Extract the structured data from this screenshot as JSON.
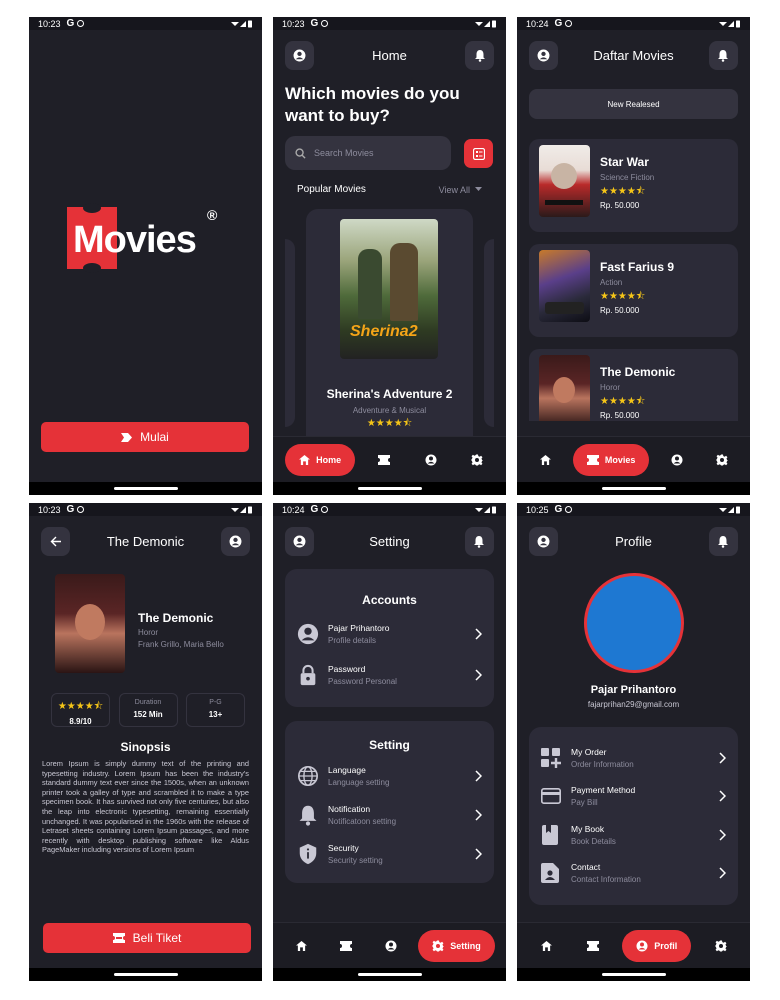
{
  "status": {
    "times": [
      "10:23",
      "10:23",
      "10:24",
      "10:23",
      "10:24",
      "10:25"
    ],
    "g": "G"
  },
  "splash": {
    "logo_text": "Movies",
    "logo_reg": "®",
    "start_label": "Mulai"
  },
  "home": {
    "title": "Home",
    "headline_1": "Which movies do you",
    "headline_2": "want to buy?",
    "search_placeholder": "Search Movies",
    "popular_label": "Popular Movies",
    "view_all": "View All",
    "featured": {
      "poster_text": "Sherina2",
      "title": "Sherina's Adventure 2",
      "genre": "Adventure & Musical",
      "rating_stars": 4.5
    },
    "nav_active_label": "Home"
  },
  "list": {
    "title": "Daftar Movies",
    "tab_label": "New Realesed",
    "movies": [
      {
        "title": "Star War",
        "genre": "Science Fiction",
        "price": "Rp. 50.000",
        "stars": 4.5
      },
      {
        "title": "Fast Farius 9",
        "genre": "Action",
        "price": "Rp. 50.000",
        "stars": 4.5
      },
      {
        "title": "The Demonic",
        "genre": "Horor",
        "price": "Rp. 50.000",
        "stars": 4.5
      }
    ],
    "nav_active_label": "Movies"
  },
  "detail": {
    "title": "The Demonic",
    "movie_title": "The Demonic",
    "genre": "Horor",
    "cast": "Frank Grillo, Maria Bello",
    "rating": "8.9/10",
    "duration_label": "Duration",
    "duration_value": "152 Min",
    "pg_label": "P-G",
    "pg_value": "13+",
    "synopsis_title": "Sinopsis",
    "synopsis": "Lorem Ipsum is simply dummy text of the printing and typesetting industry. Lorem Ipsum has been the industry's standard dummy text ever since the 1500s, when an unknown printer took a galley of type and scrambled it to make a type specimen book. It has survived not only five centuries, but also the leap into electronic typesetting, remaining essentially unchanged. It was popularised in the 1960s with the release of Letraset sheets containing Lorem Ipsum passages, and more recently with desktop publishing software like Aldus PageMaker including versions of Lorem Ipsum",
    "buy_label": "Beli Tiket"
  },
  "setting": {
    "title": "Setting",
    "accounts_title": "Accounts",
    "accounts": [
      {
        "label": "Pajar Prihantoro",
        "sub": "Profile details",
        "icon": "account-icon"
      },
      {
        "label": "Password",
        "sub": "Password Personal",
        "icon": "lock-icon"
      }
    ],
    "setting_title": "Setting",
    "settings": [
      {
        "label": "Language",
        "sub": "Language setting",
        "icon": "globe-icon"
      },
      {
        "label": "Notification",
        "sub": "Notificatoon setting",
        "icon": "bell-icon"
      },
      {
        "label": "Security",
        "sub": "Security setting",
        "icon": "shield-icon"
      }
    ],
    "nav_active_label": "Setting"
  },
  "profile": {
    "title": "Profile",
    "name": "Pajar Prihantoro",
    "email": "fajarprihan29@gmail.com",
    "items": [
      {
        "label": "My Order",
        "sub": "Order Information",
        "icon": "grid-plus-icon"
      },
      {
        "label": "Payment Method",
        "sub": "Pay Bill",
        "icon": "card-icon"
      },
      {
        "label": "My Book",
        "sub": "Book Details",
        "icon": "book-icon"
      },
      {
        "label": "Contact",
        "sub": "Contact Information",
        "icon": "contact-icon"
      }
    ],
    "nav_active_label": "Profil"
  },
  "colors": {
    "accent": "#e53238",
    "bg": "#1f1f27",
    "card": "#2c2b38",
    "star": "#f5c518",
    "avatar": "#1e78d2"
  }
}
